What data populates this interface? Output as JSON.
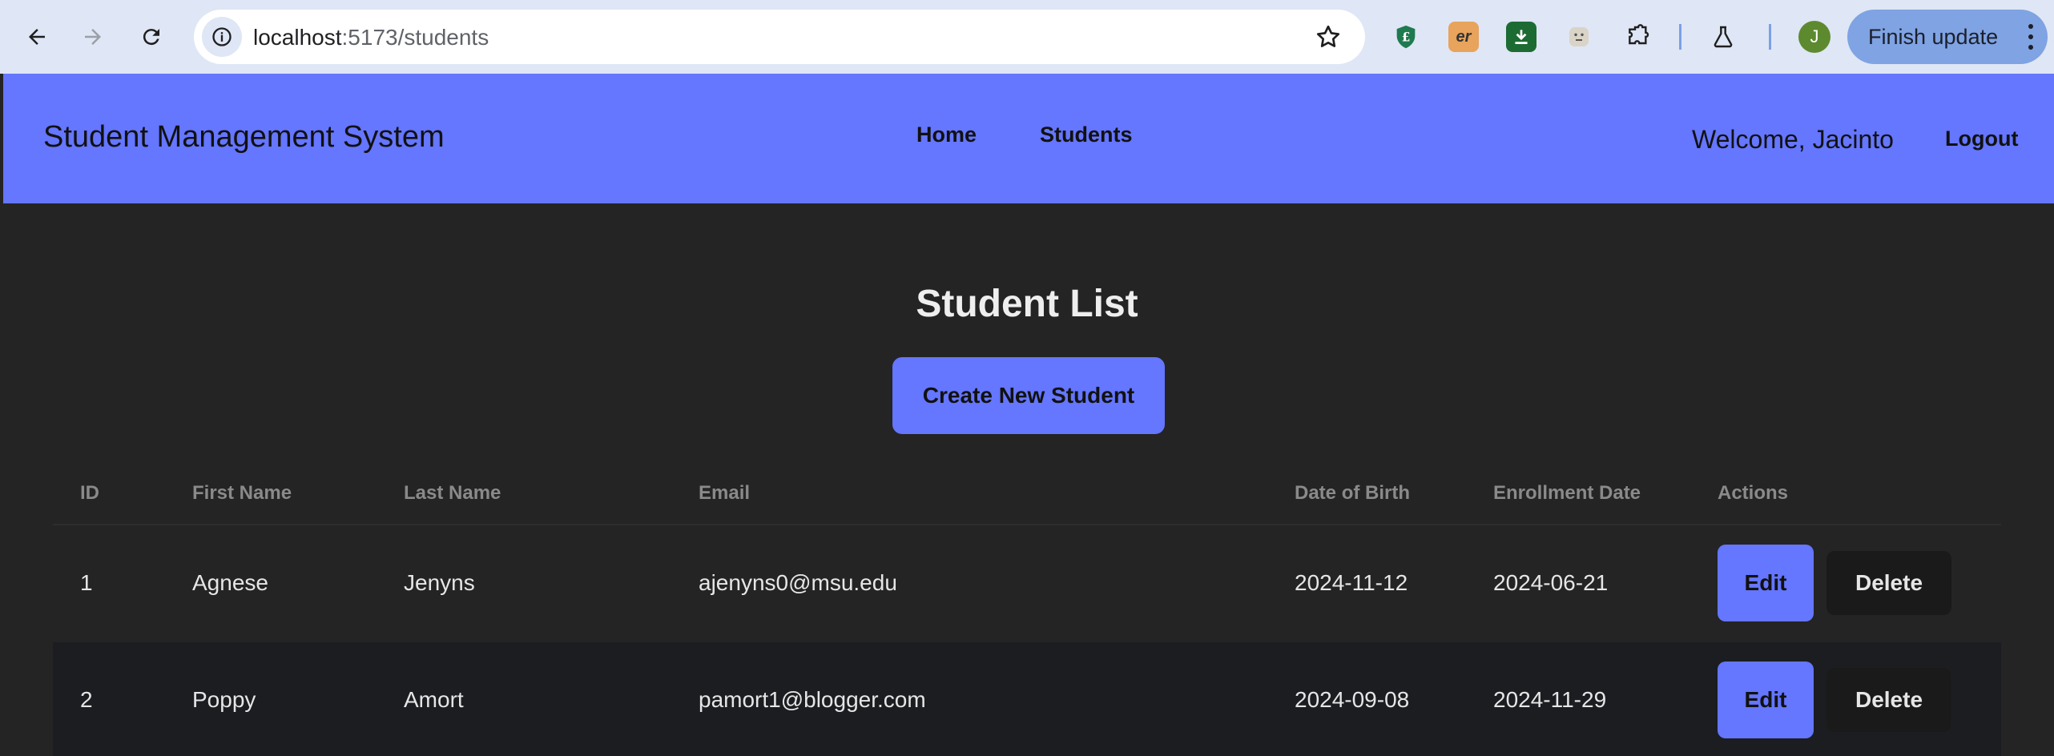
{
  "browser": {
    "url_host": "localhost",
    "url_path": ":5173/students",
    "finish_update_label": "Finish update",
    "profile_initial": "J",
    "extensions": [
      "lastpass-icon",
      "er-extension-icon",
      "download-icon",
      "face-extension-icon",
      "puzzle-icon",
      "flask-icon"
    ]
  },
  "header": {
    "title": "Student Management System",
    "nav": [
      {
        "label": "Home"
      },
      {
        "label": "Students"
      }
    ],
    "welcome": "Welcome, Jacinto",
    "logout": "Logout"
  },
  "main": {
    "title": "Student List",
    "create_button": "Create New Student",
    "table": {
      "columns": [
        "ID",
        "First Name",
        "Last Name",
        "Email",
        "Date of Birth",
        "Enrollment Date",
        "Actions"
      ],
      "rows": [
        {
          "id": "1",
          "first_name": "Agnese",
          "last_name": "Jenyns",
          "email": "ajenyns0@msu.edu",
          "dob": "2024-11-12",
          "enrollment": "2024-06-21"
        },
        {
          "id": "2",
          "first_name": "Poppy",
          "last_name": "Amort",
          "email": "pamort1@blogger.com",
          "dob": "2024-09-08",
          "enrollment": "2024-11-29"
        }
      ],
      "edit_label": "Edit",
      "delete_label": "Delete"
    }
  },
  "colors": {
    "accent": "#6576ff",
    "background": "#242424",
    "chrome": "#dfe6f5"
  }
}
